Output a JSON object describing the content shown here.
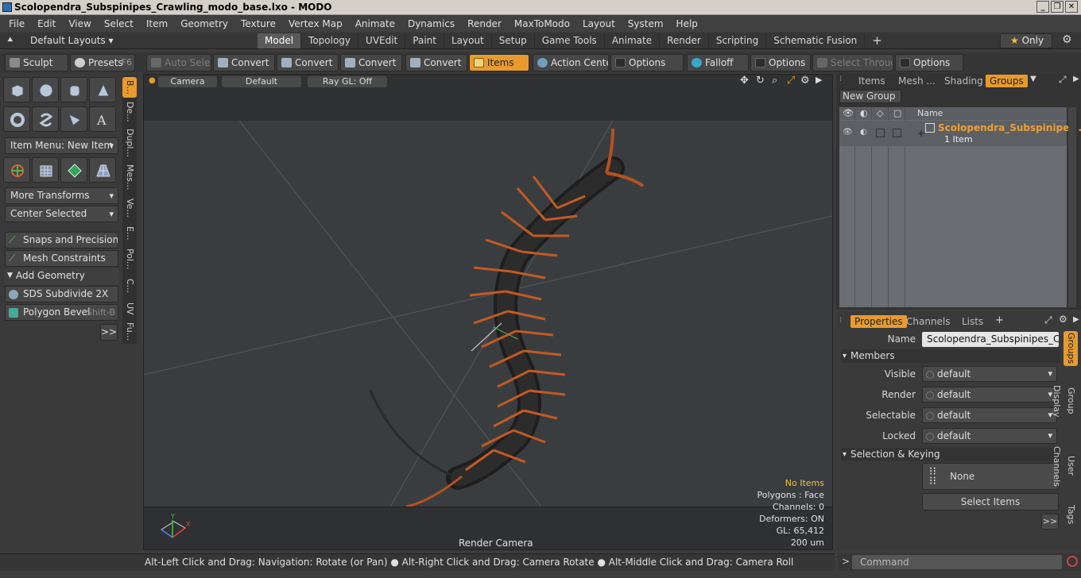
{
  "window": {
    "title": "Scolopendra_Subspinipes_Crawling_modo_base.lxo - MODO"
  },
  "menu": [
    "File",
    "Edit",
    "View",
    "Select",
    "Item",
    "Geometry",
    "Texture",
    "Vertex Map",
    "Animate",
    "Dynamics",
    "Render",
    "MaxToModo",
    "Layout",
    "System",
    "Help"
  ],
  "layout_label": "Default Layouts ▾",
  "tabs": [
    "Model",
    "Topology",
    "UVEdit",
    "Paint",
    "Layout",
    "Setup",
    "Game Tools",
    "Animate",
    "Render",
    "Scripting",
    "Schematic Fusion"
  ],
  "only_label": "Only",
  "toolbar": {
    "sculpt": "Sculpt",
    "presets": "Presets",
    "presets_key": "F6",
    "auto_select": "Auto Select",
    "convert1": "Convert",
    "convert2": "Convert",
    "convert3": "Convert",
    "convert4": "Convert",
    "items": "Items",
    "action_center": "Action Center",
    "options1": "Options",
    "falloff": "Falloff",
    "options2": "Options",
    "select_through": "Select Through",
    "options3": "Options"
  },
  "left": {
    "item_menu": "Item Menu: New Item",
    "more_transforms": "More Transforms",
    "center_selected": "Center Selected",
    "snaps": "Snaps and Precision",
    "mesh_constraints": "Mesh Constraints",
    "add_geometry": "Add Geometry",
    "sds": "SDS Subdivide 2X",
    "bevel": "Polygon Bevel",
    "bevel_key": "Shift-B",
    "more": ">>"
  },
  "vtabs": [
    "B...",
    "De...",
    "Dupl...",
    "Mes...",
    "Ve...",
    "E...",
    "Pol...",
    "C...",
    "UV",
    "Fu..."
  ],
  "viewport": {
    "camera": "Camera",
    "default": "Default",
    "raygl": "Ray GL: Off",
    "no_items": "No Items",
    "polygons": "Polygons : Face",
    "channels": "Channels: 0",
    "deformers": "Deformers: ON",
    "gl": "GL: 65,412",
    "scale": "200 um",
    "render_camera": "Render Camera"
  },
  "status": "Alt-Left Click and Drag: Navigation: Rotate (or Pan) ● Alt-Right Click and Drag: Camera Rotate ● Alt-Middle Click and Drag: Camera Roll",
  "command_placeholder": "Command",
  "right_top": {
    "tabs": [
      "Items",
      "Mesh ...",
      "Shading",
      "Groups"
    ],
    "new_group": "New Group",
    "name_col": "Name",
    "group_name": "Scolopendra_Subspinipes ...",
    "group_count": "1 Item"
  },
  "right_bottom": {
    "tabs": [
      "Properties",
      "Channels",
      "Lists"
    ],
    "name_label": "Name",
    "name_value": "Scolopendra_Subspinipes_Crawlir",
    "members": "Members",
    "visible": "Visible",
    "render": "Render",
    "selectable": "Selectable",
    "locked": "Locked",
    "default": "default",
    "selection_keying": "Selection & Keying",
    "none": "None",
    "select_items": "Select Items",
    "more": ">>",
    "vtabs": [
      "Groups",
      "Group Display",
      "User Channels",
      "Tags"
    ]
  }
}
